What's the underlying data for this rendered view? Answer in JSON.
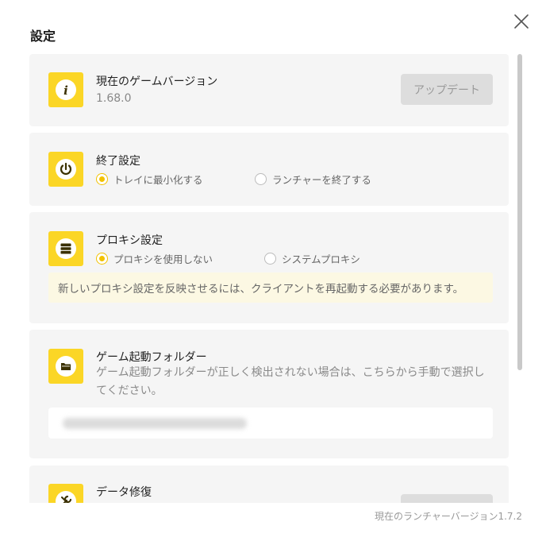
{
  "dialog": {
    "title": "設定",
    "close_icon": "close-icon"
  },
  "game_version": {
    "icon": "info-icon",
    "title": "現在のゲームバージョン",
    "version": "1.68.0",
    "update_button": "アップデート"
  },
  "exit_settings": {
    "icon": "power-icon",
    "title": "終了設定",
    "options": [
      {
        "label": "トレイに最小化する",
        "checked": true
      },
      {
        "label": "ランチャーを終了する",
        "checked": false
      }
    ]
  },
  "proxy_settings": {
    "icon": "server-icon",
    "title": "プロキシ設定",
    "options": [
      {
        "label": "プロキシを使用しない",
        "checked": true
      },
      {
        "label": "システムプロキシ",
        "checked": false
      }
    ],
    "notice": "新しいプロキシ設定を反映させるには、クライアントを再起動する必要があります。"
  },
  "launch_folder": {
    "icon": "folder-icon",
    "title": "ゲーム起動フォルダー",
    "description": "ゲーム起動フォルダーが正しく検出されない場合は、こちらから手動で選択してください。"
  },
  "data_repair": {
    "icon": "wrench-icon",
    "title": "データ修復"
  },
  "footer": {
    "launcher_version": "現在のランチャーバージョン1.7.2"
  },
  "colors": {
    "accent": "#fbd626",
    "radio_checked": "#f2c200",
    "card_bg": "#f5f5f5",
    "notice_bg": "#fcf8e3"
  }
}
